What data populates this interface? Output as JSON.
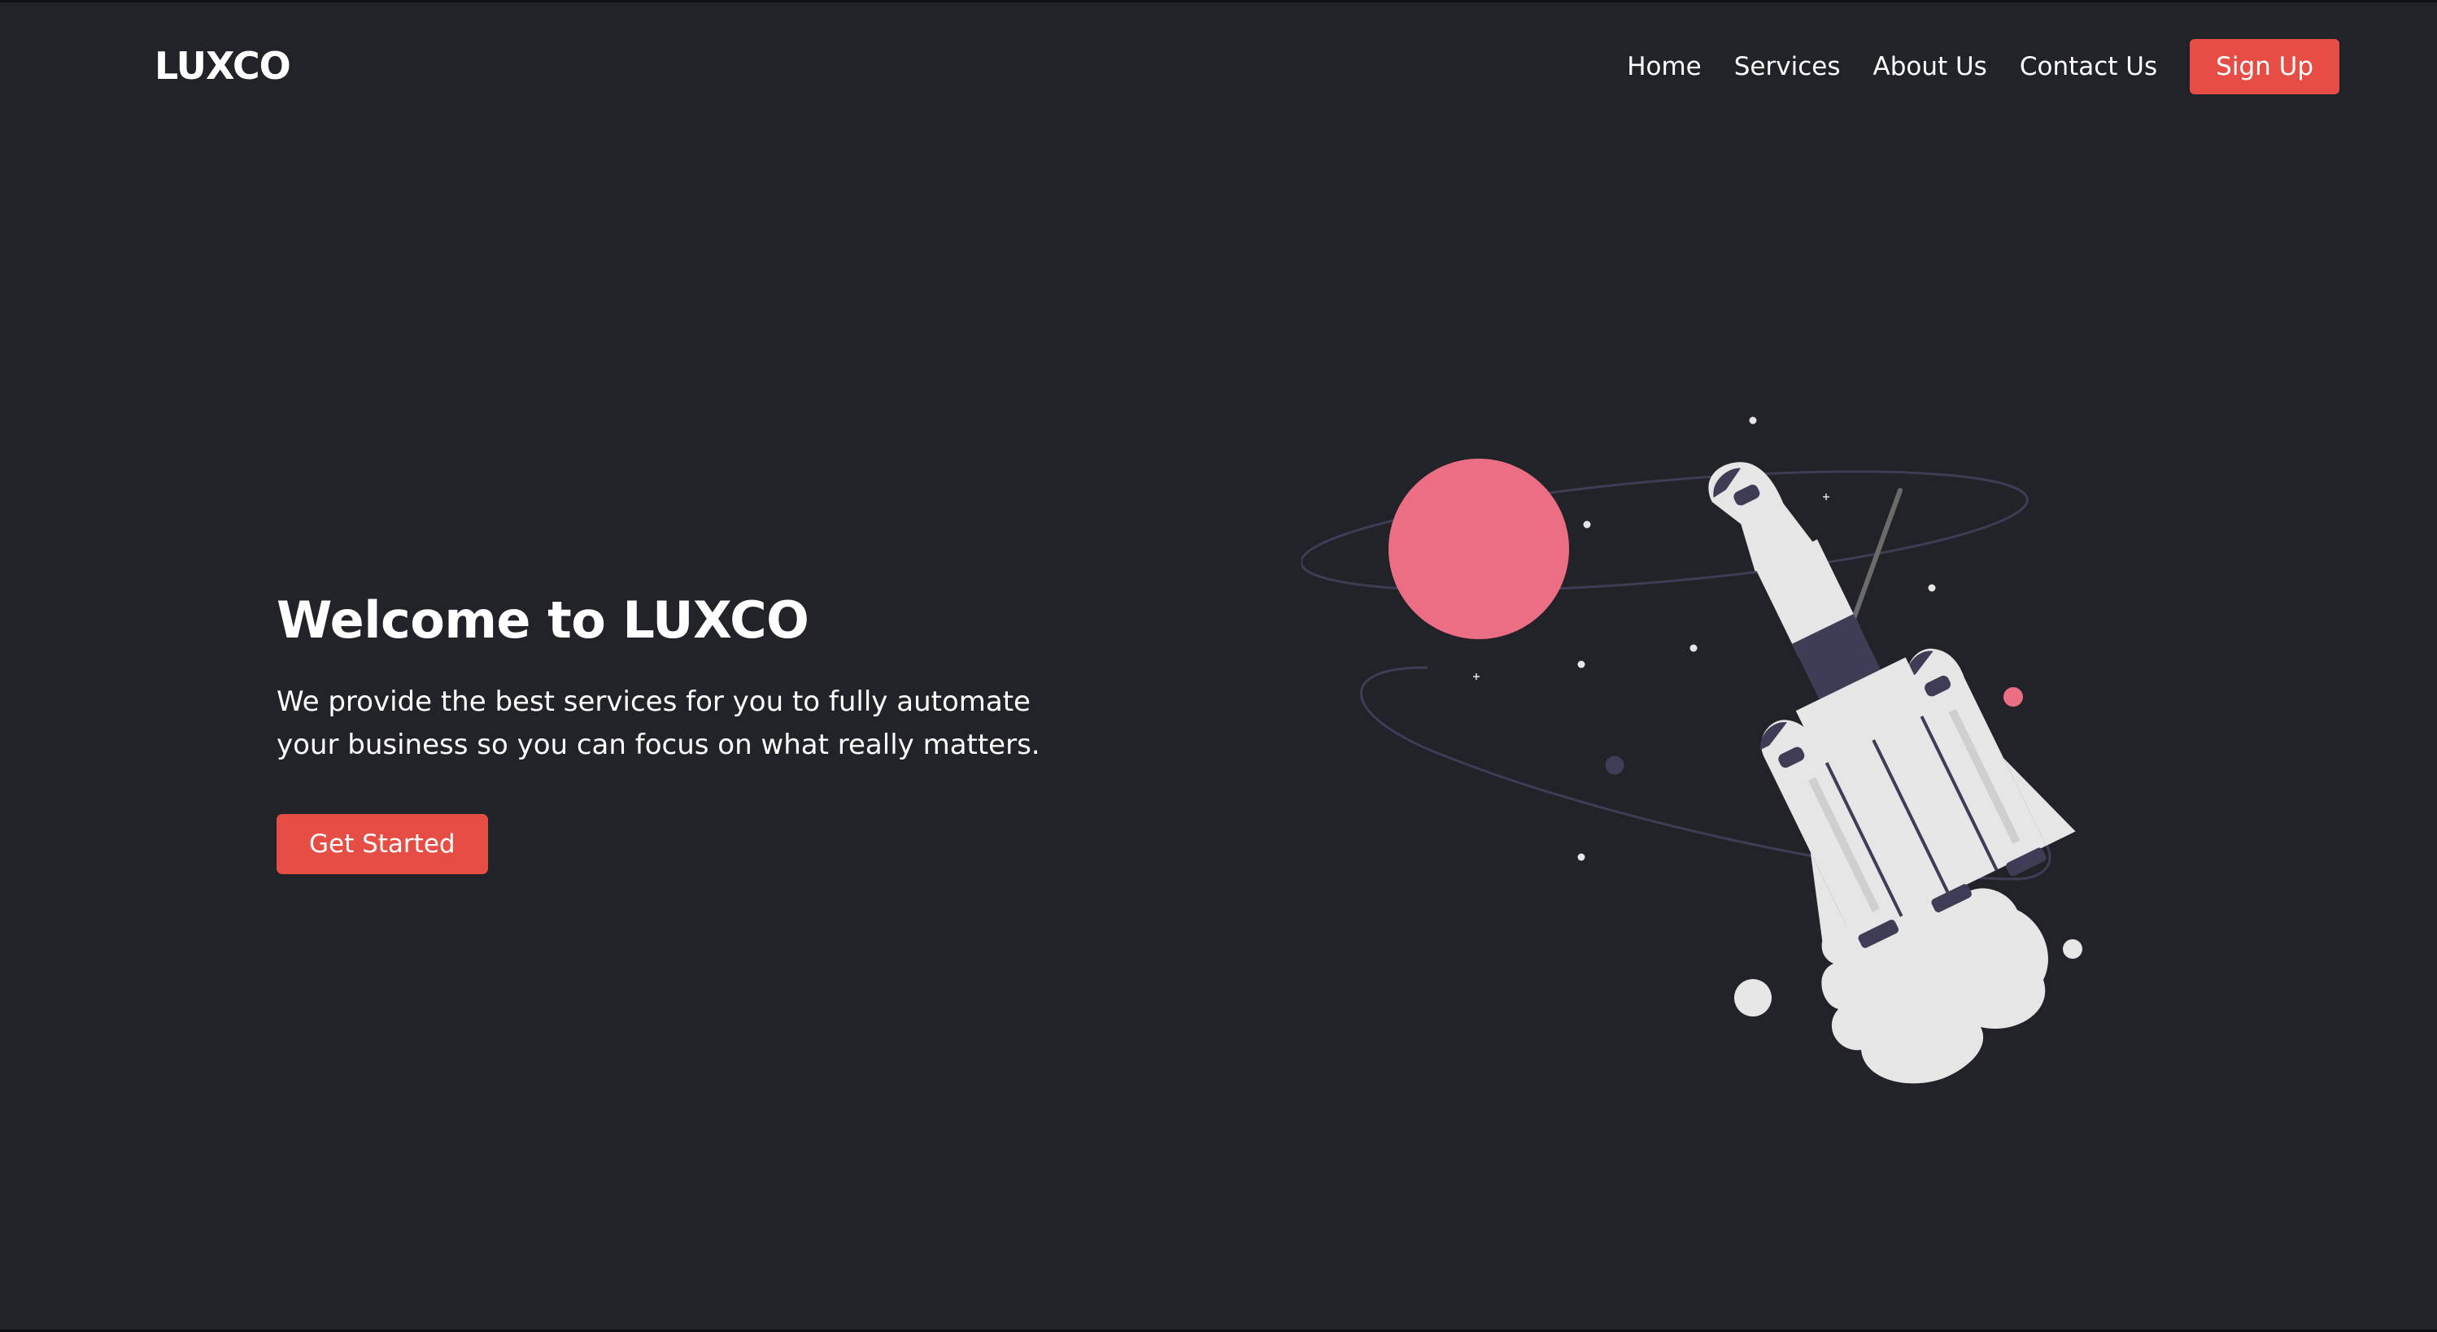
{
  "brand": {
    "name": "LUXCO",
    "accent_color": "#e64d45",
    "background_color": "#222328"
  },
  "nav": {
    "links": [
      {
        "label": "Home"
      },
      {
        "label": "Services"
      },
      {
        "label": "About Us"
      },
      {
        "label": "Contact Us"
      }
    ],
    "signup_label": "Sign Up"
  },
  "hero": {
    "title": "Welcome to LUXCO",
    "description": "We provide the best services for you to fully automate your business so you can focus on what really matters.",
    "cta_label": "Get Started"
  },
  "illustration": {
    "icon": "rocket-launch-illustration",
    "planet_color": "#ec6e85",
    "rocket_color": "#e6e6e6",
    "rocket_accent": "#3f3d56"
  }
}
